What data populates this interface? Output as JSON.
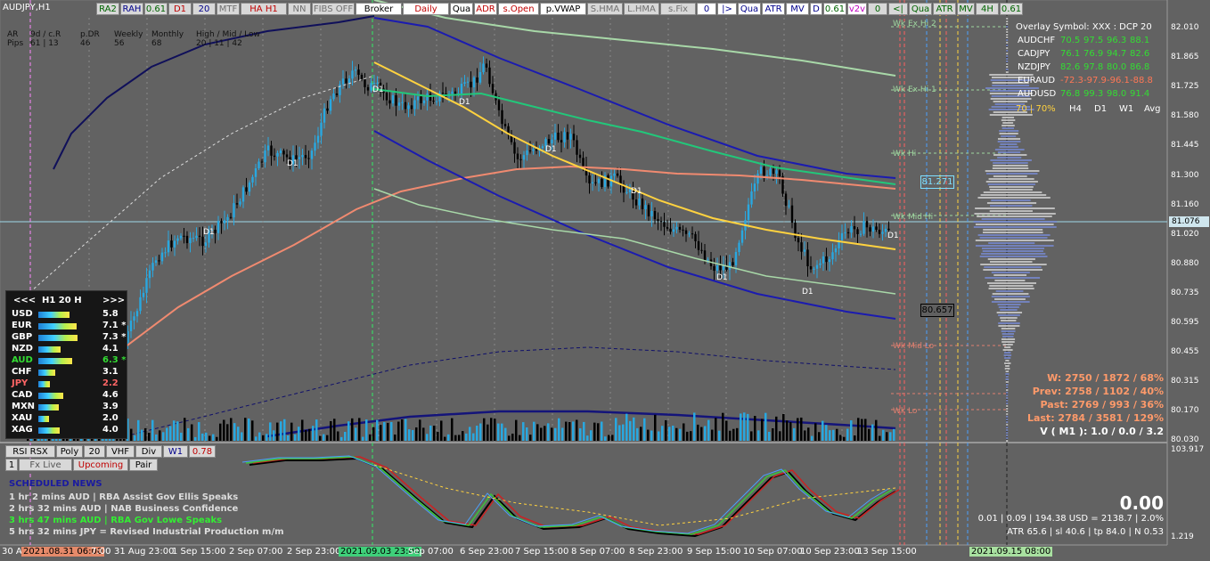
{
  "title": "AUDJPY,H1",
  "toolbar": [
    {
      "label": "RA2",
      "color": "#006400",
      "bg": "#d8d8d8"
    },
    {
      "label": "RAH",
      "color": "#00008b",
      "bg": "#d8d8d8"
    },
    {
      "label": "0.61",
      "color": "#006400",
      "bg": "#d8d8d8"
    },
    {
      "label": "D1",
      "color": "#c00000",
      "bg": "#d8d8d8"
    },
    {
      "label": "20",
      "color": "#00008b",
      "bg": "#d8d8d8"
    },
    {
      "label": "MTF",
      "color": "#707070",
      "bg": "#d8d8d8"
    },
    {
      "label": "HA H1",
      "color": "#c00000",
      "bg": "#d8d8d8"
    },
    {
      "label": "NN",
      "color": "#707070",
      "bg": "#d8d8d8"
    },
    {
      "label": "FIBS OFF",
      "color": "#707070",
      "bg": "#d8d8d8"
    },
    {
      "label": "Broker",
      "color": "#000000",
      "bg": "#ffffff"
    },
    {
      "label": "Daily",
      "color": "#c00000",
      "bg": "#ffffff"
    },
    {
      "label": "Qua",
      "color": "#000000",
      "bg": "#ffffff"
    },
    {
      "label": "ADR",
      "color": "#c00000",
      "bg": "#ffffff"
    },
    {
      "label": "s.Open",
      "color": "#c00000",
      "bg": "#ffffff"
    },
    {
      "label": "p.VWAP",
      "color": "#000000",
      "bg": "#ffffff"
    },
    {
      "label": "S.HMA",
      "color": "#707070",
      "bg": "#d8d8d8"
    },
    {
      "label": "L.HMA",
      "color": "#707070",
      "bg": "#d8d8d8"
    },
    {
      "label": "s.Fix",
      "color": "#707070",
      "bg": "#d8d8d8"
    },
    {
      "label": "0",
      "color": "#00008b",
      "bg": "#ffffff"
    },
    {
      "label": "|>",
      "color": "#00008b",
      "bg": "#ffffff"
    },
    {
      "label": "Qua",
      "color": "#00008b",
      "bg": "#ffffff"
    },
    {
      "label": "ATR",
      "color": "#00008b",
      "bg": "#ffffff"
    },
    {
      "label": "MV",
      "color": "#00008b",
      "bg": "#ffffff"
    },
    {
      "label": "D",
      "color": "#00008b",
      "bg": "#ffffff"
    },
    {
      "label": "0.61",
      "color": "#006400",
      "bg": "#ffffff"
    },
    {
      "label": "v2v",
      "color": "#c000c0",
      "bg": "#ffffff"
    },
    {
      "label": "0",
      "color": "#006400",
      "bg": "#d8d8d8"
    },
    {
      "label": "<|",
      "color": "#006400",
      "bg": "#d8d8d8"
    },
    {
      "label": "Qua",
      "color": "#006400",
      "bg": "#d8d8d8"
    },
    {
      "label": "ATR",
      "color": "#006400",
      "bg": "#d8d8d8"
    },
    {
      "label": "MV",
      "color": "#006400",
      "bg": "#d8d8d8"
    },
    {
      "label": "4H",
      "color": "#006400",
      "bg": "#d8d8d8"
    },
    {
      "label": "0.61",
      "color": "#006400",
      "bg": "#d8d8d8"
    }
  ],
  "stats": {
    "headers": [
      "AR",
      "9d / c.R",
      "p.DR",
      "Weekly",
      "Monthly",
      "High / Mid / Low"
    ],
    "row_label": "Pips",
    "values": [
      "61 | 13",
      "46",
      "56",
      "68",
      "20 | 11 | 42"
    ]
  },
  "strength_panel": {
    "nav_prev": "<<<",
    "title": "H1  20  H",
    "nav_next": ">>>",
    "rows": [
      {
        "name": "USD",
        "value": "5.8",
        "color": "#ffffff",
        "bar": 0.58
      },
      {
        "name": "EUR",
        "value": "7.1 *",
        "color": "#ffffff",
        "bar": 0.71
      },
      {
        "name": "GBP",
        "value": "7.3 *",
        "color": "#ffffff",
        "bar": 0.73
      },
      {
        "name": "NZD",
        "value": "4.1",
        "color": "#ffffff",
        "bar": 0.41
      },
      {
        "name": "AUD",
        "value": "6.3 *",
        "color": "#33dd33",
        "bar": 0.63
      },
      {
        "name": "CHF",
        "value": "3.1",
        "color": "#ffffff",
        "bar": 0.31
      },
      {
        "name": "JPY",
        "value": "2.2",
        "color": "#ff6666",
        "bar": 0.22
      },
      {
        "name": "CAD",
        "value": "4.6",
        "color": "#ffffff",
        "bar": 0.46
      },
      {
        "name": "MXN",
        "value": "3.9",
        "color": "#ffffff",
        "bar": 0.39
      },
      {
        "name": "XAU",
        "value": "2.0",
        "color": "#ffffff",
        "bar": 0.2
      },
      {
        "name": "XAG",
        "value": "4.0",
        "color": "#ffffff",
        "bar": 0.4
      }
    ]
  },
  "overlay": {
    "title": "Overlay Symbol: XXX : DCP 20",
    "rows": [
      {
        "sym": "AUDCHF",
        "v": [
          "70.5",
          "97.5",
          "96.3",
          "88.1"
        ],
        "color": "#33dd33"
      },
      {
        "sym": "CADJPY",
        "v": [
          "76.1",
          "76.9",
          "94.7",
          "82.6"
        ],
        "color": "#33dd33"
      },
      {
        "sym": "NZDJPY",
        "v": [
          "82.6",
          "97.8",
          "80.0",
          "86.8"
        ],
        "color": "#33dd33"
      },
      {
        "sym": "EURAUD",
        "v": [
          "-72.3",
          "-97.9",
          "-96.1",
          "-88.8"
        ],
        "color": "#ff7755"
      },
      {
        "sym": "AUDUSD",
        "v": [
          "76.8",
          "99.3",
          "98.0",
          "91.4"
        ],
        "color": "#33dd33"
      }
    ],
    "footer_pct": "70 | 70%",
    "footer_cols": [
      "H4",
      "D1",
      "W1",
      "Avg"
    ]
  },
  "level_labels": [
    "Wk Ex Hi 2",
    "Wk Ex Hi 1",
    "Wk Hi",
    "Wk Mid Hi",
    "Wk Mid Lo",
    "Wk Lo"
  ],
  "price_boxes": {
    "upper": "81.271",
    "lower": "80.657",
    "current": "81.076"
  },
  "d1_marker": "D1",
  "y_axis": [
    "82.010",
    "81.865",
    "81.725",
    "81.580",
    "81.445",
    "81.300",
    "81.160",
    "81.020",
    "80.880",
    "80.735",
    "80.595",
    "80.455",
    "80.315",
    "80.170",
    "80.030"
  ],
  "sub_y_axis": {
    "top": "103.917",
    "bottom": "1.219"
  },
  "x_axis": [
    "30 A",
    "2021.08.31 06:00",
    "7:00",
    "31 Aug 23:00",
    "1 Sep 15:00",
    "2 Sep 07:00",
    "2 Sep 23:00",
    "2021.09.03 23:00",
    "Sep 07:00",
    "6 Sep 23:00",
    "7 Sep 15:00",
    "8 Sep 07:00",
    "8 Sep 23:00",
    "9 Sep 15:00",
    "10 Sep 07:00",
    "10 Sep 23:00",
    "13 Sep 15:00",
    "2021.09.15 08:00"
  ],
  "winrate": [
    {
      "text": "W: 2750 / 1872 / 68%"
    },
    {
      "text": "Prev: 2758 / 1102 / 40%"
    },
    {
      "text": "Past: 2769 / 993 / 36%"
    },
    {
      "text": "Last: 2784 / 3581 / 129%"
    }
  ],
  "vol_line": "V ( M1 ): 1.0 / 0.0 / 3.2",
  "sub_buttons_row1": [
    {
      "label": "RSI RSX",
      "color": "#000000"
    },
    {
      "label": "Poly",
      "color": "#000000"
    },
    {
      "label": "20",
      "color": "#000000"
    },
    {
      "label": "VHF",
      "color": "#000000"
    },
    {
      "label": "Div",
      "color": "#000000"
    },
    {
      "label": "W1",
      "color": "#00008b"
    },
    {
      "label": "0.78",
      "color": "#c00000"
    }
  ],
  "sub_buttons_row2": [
    {
      "label": "1",
      "color": "#000000"
    },
    {
      "label": "Fx Live",
      "color": "#555555"
    },
    {
      "label": "Upcoming",
      "color": "#c00000"
    },
    {
      "label": "Pair",
      "color": "#000000"
    }
  ],
  "news": {
    "title": "SCHEDULED NEWS",
    "items": [
      {
        "text": "1 hr 2 mins  AUD  |  RBA Assist Gov Ellis Speaks",
        "color": "#dddddd"
      },
      {
        "text": "2 hrs 32 mins  AUD  |  NAB Business Confidence",
        "color": "#dddddd"
      },
      {
        "text": "3 hrs 47 mins  AUD  |  RBA Gov Lowe Speaks",
        "color": "#33ee33"
      },
      {
        "text": "5 hrs 32 mins  JPY  =  Revised Industrial Production m/m",
        "color": "#dddddd"
      }
    ]
  },
  "sub_value": "0.00",
  "sub_info1": "0.01  |  0.09  |  194.38 USD = 2138.7  |  2.0%",
  "sub_info2": "ATR 65.6  |  sl 40.6  |  tp 84.0  |  N 0.53",
  "colors": {
    "bull": "#29a8e0",
    "bear": "#000000",
    "ema_slow": "#f08a70",
    "ema_fast": "#ffd23f",
    "green": "#22c77a",
    "blue": "#1b1bb0"
  }
}
